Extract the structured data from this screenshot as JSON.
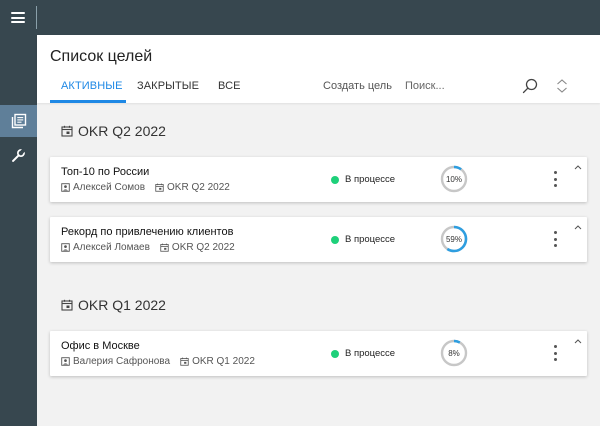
{
  "header": {
    "title": "Список целей",
    "tabs": [
      {
        "label": "АКТИВНЫЕ",
        "active": true
      },
      {
        "label": "ЗАКРЫТЫЕ",
        "active": false
      },
      {
        "label": "ВСЕ",
        "active": false
      }
    ],
    "create_goal_label": "Создать цель",
    "search_placeholder": "Поиск..."
  },
  "colors": {
    "accent": "#1e88e5",
    "topbar": "#37474f",
    "status_in_progress": "#1ed07a",
    "progress_track": "#c7c7c7",
    "progress_fill": "#2e9ee0"
  },
  "groups": [
    {
      "title": "OKR Q2 2022",
      "goals": [
        {
          "name": "Топ-10 по России",
          "owner": "Алексей Сомов",
          "period": "OKR Q2 2022",
          "status": "В процессе",
          "progress_label": "10%",
          "progress": 10
        },
        {
          "name": "Рекорд по привлечению клиентов",
          "owner": "Алексей Ломаев",
          "period": "OKR Q2 2022",
          "status": "В процессе",
          "progress_label": "59%",
          "progress": 59
        }
      ]
    },
    {
      "title": "OKR Q1 2022",
      "goals": [
        {
          "name": "Офис в Москве",
          "owner": "Валерия Сафронова",
          "period": "OKR Q1 2022",
          "status": "В процессе",
          "progress_label": "8%",
          "progress": 8
        }
      ]
    }
  ]
}
